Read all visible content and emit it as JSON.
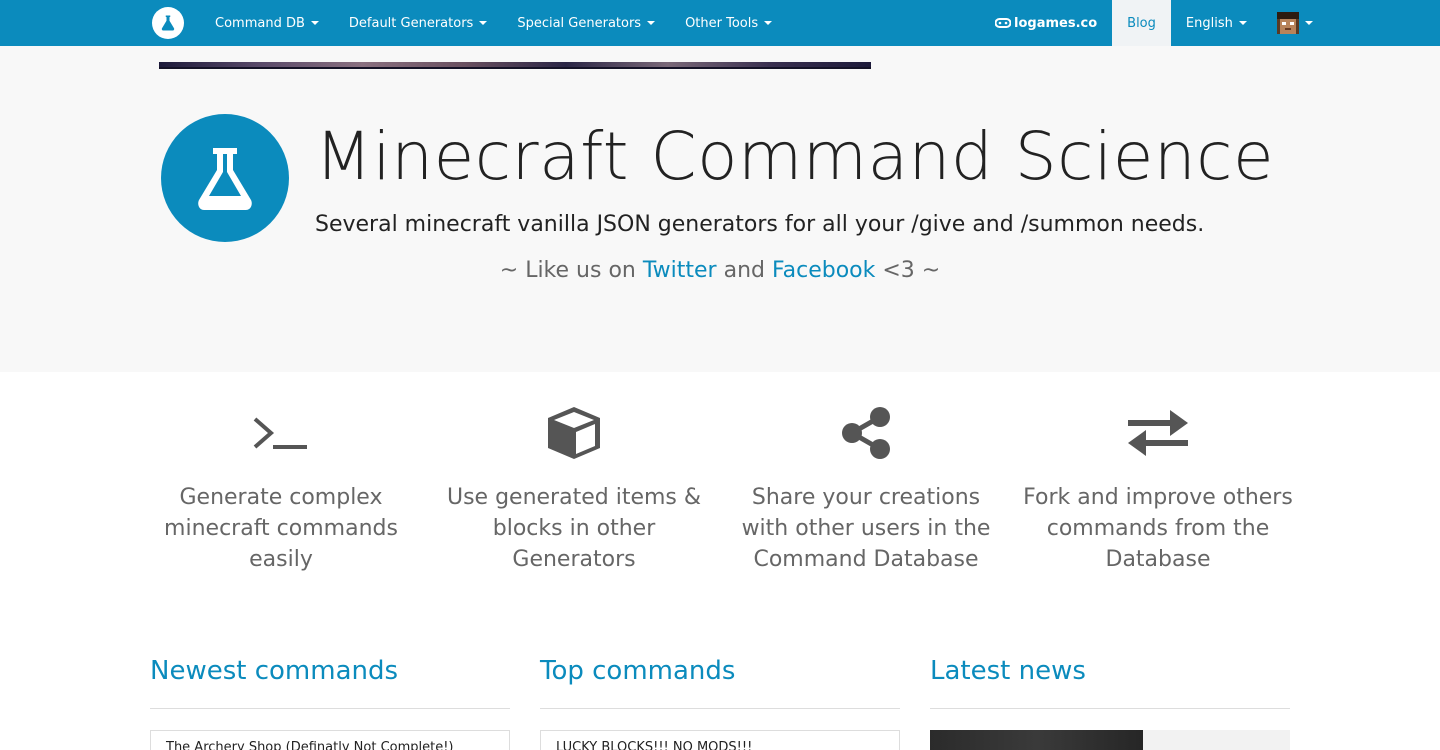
{
  "navbar": {
    "menu": [
      {
        "label": "Command DB"
      },
      {
        "label": "Default Generators"
      },
      {
        "label": "Special Generators"
      },
      {
        "label": "Other Tools"
      }
    ],
    "logames_label": "logames.co",
    "blog_label": "Blog",
    "language_label": "English"
  },
  "hero": {
    "title": "Minecraft Command Science",
    "subtitle": "Several minecraft vanilla JSON generators for all your /give and /summon needs.",
    "social_prefix": "~ Like us on",
    "twitter_label": "Twitter",
    "social_and": "and",
    "facebook_label": "Facebook",
    "social_suffix": "<3 ~"
  },
  "features": [
    {
      "icon": "terminal-icon",
      "text": "Generate complex minecraft commands easily"
    },
    {
      "icon": "cube-icon",
      "text": "Use generated items & blocks in other Generators"
    },
    {
      "icon": "share-icon",
      "text": "Share your creations with other users in the Command Database"
    },
    {
      "icon": "exchange-icon",
      "text": "Fork and improve others commands from the Database"
    }
  ],
  "sections": {
    "newest": {
      "title": "Newest commands",
      "first_item": "The Archery Shop (Definatly Not Complete!)"
    },
    "top": {
      "title": "Top commands",
      "first_item": "LUCKY BLOCKS!!! NO MODS!!!"
    },
    "news": {
      "title": "Latest news"
    }
  },
  "colors": {
    "primary": "#0b8bbd",
    "hero_bg": "#f8f8f8"
  }
}
